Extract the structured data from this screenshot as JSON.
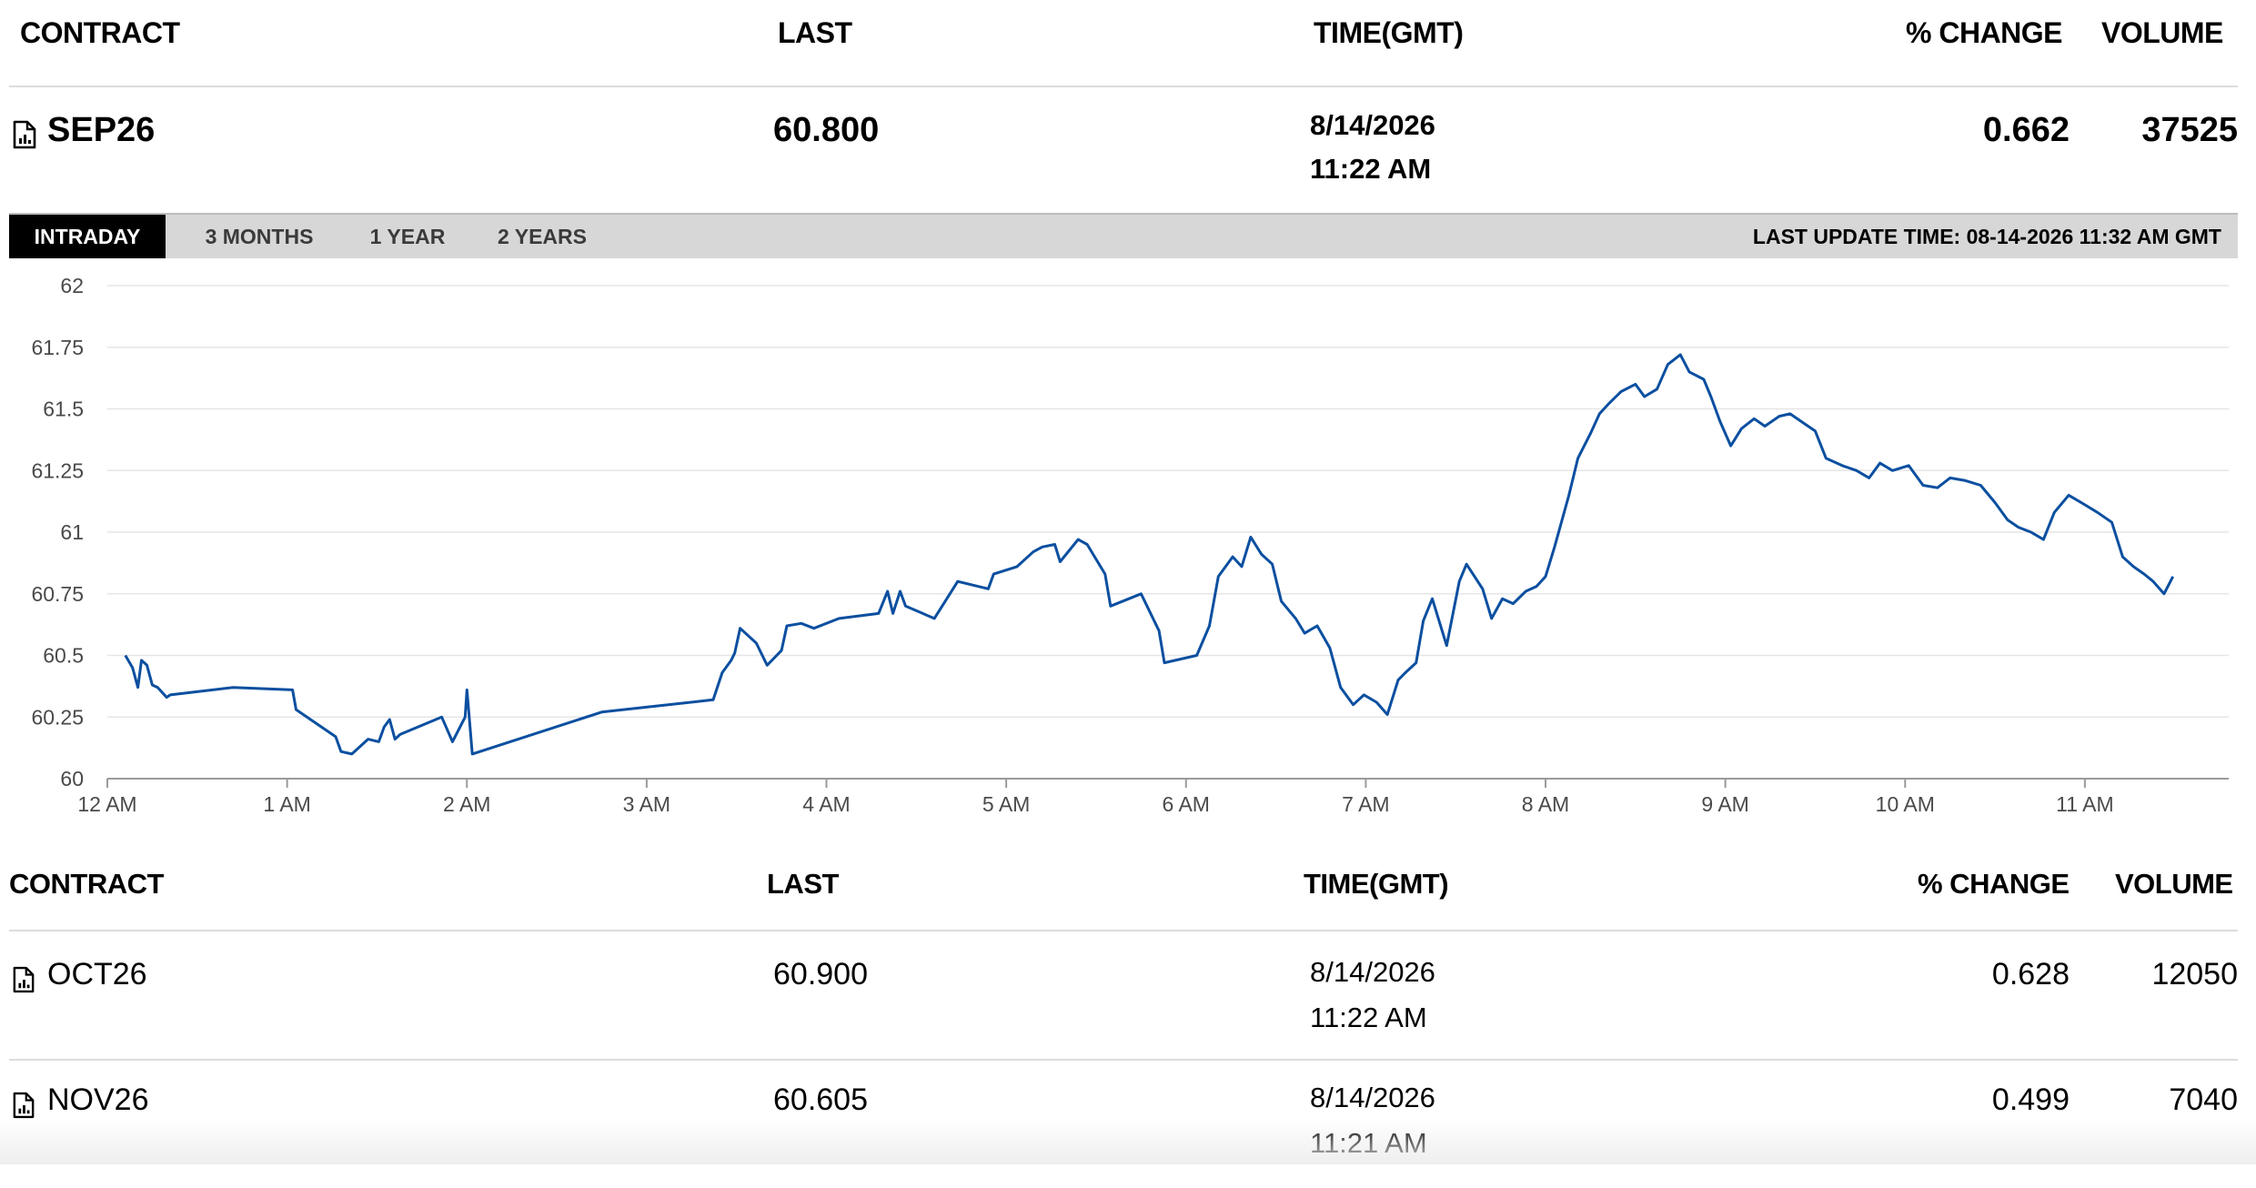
{
  "header": {
    "contract": "CONTRACT",
    "last": "LAST",
    "time": "TIME(GMT)",
    "pct_change": "% CHANGE",
    "volume": "VOLUME"
  },
  "main": {
    "contract": "SEP26",
    "last": "60.800",
    "date": "8/14/2026",
    "time": "11:22 AM",
    "pct_change": "0.662",
    "volume": "37525",
    "icon": "document-chart-icon"
  },
  "tabs": [
    {
      "label": "INTRADAY",
      "active": true
    },
    {
      "label": "3 MONTHS",
      "active": false
    },
    {
      "label": "1 YEAR",
      "active": false
    },
    {
      "label": "2 YEARS",
      "active": false
    }
  ],
  "last_update": "LAST UPDATE TIME: 08-14-2026 11:32 AM GMT",
  "colors": {
    "line": "#0b4fa0",
    "grid": "#e6e6e6",
    "active_tab": "#000000",
    "tabbar": "#d7d7d7"
  },
  "chart_data": {
    "type": "line",
    "x_unit": "hour (GMT)",
    "ylim": [
      60,
      62
    ],
    "y_ticks": [
      "60",
      "60.25",
      "60.5",
      "60.75",
      "61",
      "61.25",
      "61.5",
      "61.75",
      "62"
    ],
    "x_ticks": [
      "12 AM",
      "1 AM",
      "2 AM",
      "3 AM",
      "4 AM",
      "5 AM",
      "6 AM",
      "7 AM",
      "8 AM",
      "9 AM",
      "10 AM",
      "11 AM"
    ],
    "grid": true,
    "series": [
      {
        "values": [
          [
            0.1,
            60.5
          ],
          [
            0.14,
            60.45
          ],
          [
            0.17,
            60.37
          ],
          [
            0.19,
            60.48
          ],
          [
            0.22,
            60.46
          ],
          [
            0.25,
            60.38
          ],
          [
            0.28,
            60.37
          ],
          [
            0.33,
            60.33
          ],
          [
            0.35,
            60.34
          ],
          [
            0.7,
            60.37
          ],
          [
            1.03,
            60.36
          ],
          [
            1.05,
            60.28
          ],
          [
            1.27,
            60.17
          ],
          [
            1.3,
            60.11
          ],
          [
            1.36,
            60.1
          ],
          [
            1.45,
            60.16
          ],
          [
            1.51,
            60.15
          ],
          [
            1.54,
            60.21
          ],
          [
            1.57,
            60.24
          ],
          [
            1.6,
            60.16
          ],
          [
            1.63,
            60.18
          ],
          [
            1.86,
            60.25
          ],
          [
            1.89,
            60.2
          ],
          [
            1.92,
            60.15
          ],
          [
            1.99,
            60.25
          ],
          [
            2.0,
            60.36
          ],
          [
            2.03,
            60.1
          ],
          [
            2.75,
            60.27
          ],
          [
            3.37,
            60.32
          ],
          [
            3.42,
            60.43
          ],
          [
            3.47,
            60.48
          ],
          [
            3.49,
            60.51
          ],
          [
            3.52,
            60.61
          ],
          [
            3.61,
            60.55
          ],
          [
            3.67,
            60.46
          ],
          [
            3.75,
            60.52
          ],
          [
            3.78,
            60.62
          ],
          [
            3.86,
            60.63
          ],
          [
            3.93,
            60.61
          ],
          [
            4.07,
            60.65
          ],
          [
            4.29,
            60.67
          ],
          [
            4.34,
            60.76
          ],
          [
            4.37,
            60.67
          ],
          [
            4.41,
            60.76
          ],
          [
            4.44,
            60.7
          ],
          [
            4.6,
            60.65
          ],
          [
            4.73,
            60.8
          ],
          [
            4.9,
            60.77
          ],
          [
            4.93,
            60.83
          ],
          [
            5.06,
            60.86
          ],
          [
            5.15,
            60.92
          ],
          [
            5.2,
            60.94
          ],
          [
            5.27,
            60.95
          ],
          [
            5.3,
            60.88
          ],
          [
            5.4,
            60.97
          ],
          [
            5.45,
            60.95
          ],
          [
            5.55,
            60.83
          ],
          [
            5.58,
            60.7
          ],
          [
            5.75,
            60.75
          ],
          [
            5.85,
            60.6
          ],
          [
            5.88,
            60.47
          ],
          [
            6.06,
            60.5
          ],
          [
            6.13,
            60.62
          ],
          [
            6.18,
            60.82
          ],
          [
            6.26,
            60.9
          ],
          [
            6.31,
            60.86
          ],
          [
            6.36,
            60.98
          ],
          [
            6.42,
            60.91
          ],
          [
            6.48,
            60.87
          ],
          [
            6.53,
            60.72
          ],
          [
            6.61,
            60.65
          ],
          [
            6.66,
            60.59
          ],
          [
            6.73,
            60.62
          ],
          [
            6.8,
            60.53
          ],
          [
            6.86,
            60.37
          ],
          [
            6.93,
            60.3
          ],
          [
            6.99,
            60.34
          ],
          [
            7.06,
            60.31
          ],
          [
            7.12,
            60.26
          ],
          [
            7.18,
            60.4
          ],
          [
            7.22,
            60.43
          ],
          [
            7.28,
            60.47
          ],
          [
            7.32,
            60.64
          ],
          [
            7.37,
            60.73
          ],
          [
            7.45,
            60.54
          ],
          [
            7.52,
            60.8
          ],
          [
            7.56,
            60.87
          ],
          [
            7.65,
            60.77
          ],
          [
            7.7,
            60.65
          ],
          [
            7.76,
            60.73
          ],
          [
            7.82,
            60.71
          ],
          [
            7.89,
            60.76
          ],
          [
            7.95,
            60.78
          ],
          [
            8.0,
            60.82
          ],
          [
            8.05,
            60.94
          ],
          [
            8.13,
            61.15
          ],
          [
            8.18,
            61.3
          ],
          [
            8.25,
            61.4
          ],
          [
            8.3,
            61.48
          ],
          [
            8.35,
            61.52
          ],
          [
            8.42,
            61.57
          ],
          [
            8.5,
            61.6
          ],
          [
            8.55,
            61.55
          ],
          [
            8.62,
            61.58
          ],
          [
            8.68,
            61.68
          ],
          [
            8.75,
            61.72
          ],
          [
            8.8,
            61.65
          ],
          [
            8.88,
            61.62
          ],
          [
            8.92,
            61.55
          ],
          [
            8.97,
            61.45
          ],
          [
            9.03,
            61.35
          ],
          [
            9.09,
            61.42
          ],
          [
            9.16,
            61.46
          ],
          [
            9.22,
            61.43
          ],
          [
            9.3,
            61.47
          ],
          [
            9.36,
            61.48
          ],
          [
            9.42,
            61.45
          ],
          [
            9.5,
            61.41
          ],
          [
            9.56,
            61.3
          ],
          [
            9.65,
            61.27
          ],
          [
            9.73,
            61.25
          ],
          [
            9.8,
            61.22
          ],
          [
            9.86,
            61.28
          ],
          [
            9.93,
            61.25
          ],
          [
            10.02,
            61.27
          ],
          [
            10.1,
            61.19
          ],
          [
            10.18,
            61.18
          ],
          [
            10.25,
            61.22
          ],
          [
            10.33,
            61.21
          ],
          [
            10.42,
            61.19
          ],
          [
            10.5,
            61.12
          ],
          [
            10.57,
            61.05
          ],
          [
            10.63,
            61.02
          ],
          [
            10.7,
            61.0
          ],
          [
            10.77,
            60.97
          ],
          [
            10.83,
            61.08
          ],
          [
            10.91,
            61.15
          ],
          [
            10.98,
            61.12
          ],
          [
            11.07,
            61.08
          ],
          [
            11.15,
            61.04
          ],
          [
            11.21,
            60.9
          ],
          [
            11.27,
            60.86
          ],
          [
            11.33,
            60.83
          ],
          [
            11.38,
            60.8
          ],
          [
            11.44,
            60.75
          ],
          [
            11.49,
            60.82
          ]
        ]
      }
    ]
  },
  "table_header": {
    "contract": "CONTRACT",
    "last": "LAST",
    "time": "TIME(GMT)",
    "pct_change": "% CHANGE",
    "volume": "VOLUME"
  },
  "rows": [
    {
      "contract": "OCT26",
      "last": "60.900",
      "date": "8/14/2026",
      "time": "11:22 AM",
      "pct_change": "0.628",
      "volume": "12050"
    },
    {
      "contract": "NOV26",
      "last": "60.605",
      "date": "8/14/2026",
      "time": "11:21 AM",
      "pct_change": "0.499",
      "volume": "7040"
    }
  ]
}
